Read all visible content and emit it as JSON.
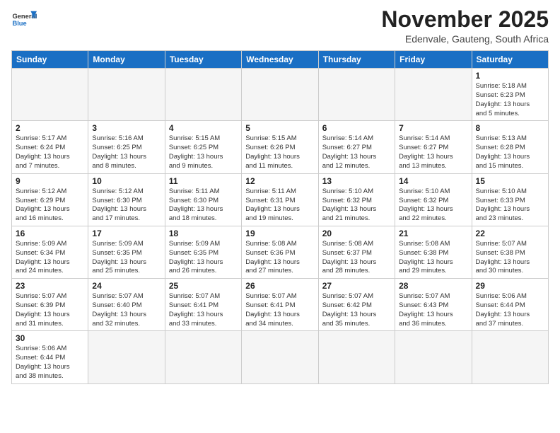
{
  "logo": {
    "text_general": "General",
    "text_blue": "Blue"
  },
  "header": {
    "month": "November 2025",
    "location": "Edenvale, Gauteng, South Africa"
  },
  "weekdays": [
    "Sunday",
    "Monday",
    "Tuesday",
    "Wednesday",
    "Thursday",
    "Friday",
    "Saturday"
  ],
  "weeks": [
    [
      {
        "day": "",
        "info": ""
      },
      {
        "day": "",
        "info": ""
      },
      {
        "day": "",
        "info": ""
      },
      {
        "day": "",
        "info": ""
      },
      {
        "day": "",
        "info": ""
      },
      {
        "day": "",
        "info": ""
      },
      {
        "day": "1",
        "info": "Sunrise: 5:18 AM\nSunset: 6:23 PM\nDaylight: 13 hours\nand 5 minutes."
      }
    ],
    [
      {
        "day": "2",
        "info": "Sunrise: 5:17 AM\nSunset: 6:24 PM\nDaylight: 13 hours\nand 7 minutes."
      },
      {
        "day": "3",
        "info": "Sunrise: 5:16 AM\nSunset: 6:25 PM\nDaylight: 13 hours\nand 8 minutes."
      },
      {
        "day": "4",
        "info": "Sunrise: 5:15 AM\nSunset: 6:25 PM\nDaylight: 13 hours\nand 9 minutes."
      },
      {
        "day": "5",
        "info": "Sunrise: 5:15 AM\nSunset: 6:26 PM\nDaylight: 13 hours\nand 11 minutes."
      },
      {
        "day": "6",
        "info": "Sunrise: 5:14 AM\nSunset: 6:27 PM\nDaylight: 13 hours\nand 12 minutes."
      },
      {
        "day": "7",
        "info": "Sunrise: 5:14 AM\nSunset: 6:27 PM\nDaylight: 13 hours\nand 13 minutes."
      },
      {
        "day": "8",
        "info": "Sunrise: 5:13 AM\nSunset: 6:28 PM\nDaylight: 13 hours\nand 15 minutes."
      }
    ],
    [
      {
        "day": "9",
        "info": "Sunrise: 5:12 AM\nSunset: 6:29 PM\nDaylight: 13 hours\nand 16 minutes."
      },
      {
        "day": "10",
        "info": "Sunrise: 5:12 AM\nSunset: 6:30 PM\nDaylight: 13 hours\nand 17 minutes."
      },
      {
        "day": "11",
        "info": "Sunrise: 5:11 AM\nSunset: 6:30 PM\nDaylight: 13 hours\nand 18 minutes."
      },
      {
        "day": "12",
        "info": "Sunrise: 5:11 AM\nSunset: 6:31 PM\nDaylight: 13 hours\nand 19 minutes."
      },
      {
        "day": "13",
        "info": "Sunrise: 5:10 AM\nSunset: 6:32 PM\nDaylight: 13 hours\nand 21 minutes."
      },
      {
        "day": "14",
        "info": "Sunrise: 5:10 AM\nSunset: 6:32 PM\nDaylight: 13 hours\nand 22 minutes."
      },
      {
        "day": "15",
        "info": "Sunrise: 5:10 AM\nSunset: 6:33 PM\nDaylight: 13 hours\nand 23 minutes."
      }
    ],
    [
      {
        "day": "16",
        "info": "Sunrise: 5:09 AM\nSunset: 6:34 PM\nDaylight: 13 hours\nand 24 minutes."
      },
      {
        "day": "17",
        "info": "Sunrise: 5:09 AM\nSunset: 6:35 PM\nDaylight: 13 hours\nand 25 minutes."
      },
      {
        "day": "18",
        "info": "Sunrise: 5:09 AM\nSunset: 6:35 PM\nDaylight: 13 hours\nand 26 minutes."
      },
      {
        "day": "19",
        "info": "Sunrise: 5:08 AM\nSunset: 6:36 PM\nDaylight: 13 hours\nand 27 minutes."
      },
      {
        "day": "20",
        "info": "Sunrise: 5:08 AM\nSunset: 6:37 PM\nDaylight: 13 hours\nand 28 minutes."
      },
      {
        "day": "21",
        "info": "Sunrise: 5:08 AM\nSunset: 6:38 PM\nDaylight: 13 hours\nand 29 minutes."
      },
      {
        "day": "22",
        "info": "Sunrise: 5:07 AM\nSunset: 6:38 PM\nDaylight: 13 hours\nand 30 minutes."
      }
    ],
    [
      {
        "day": "23",
        "info": "Sunrise: 5:07 AM\nSunset: 6:39 PM\nDaylight: 13 hours\nand 31 minutes."
      },
      {
        "day": "24",
        "info": "Sunrise: 5:07 AM\nSunset: 6:40 PM\nDaylight: 13 hours\nand 32 minutes."
      },
      {
        "day": "25",
        "info": "Sunrise: 5:07 AM\nSunset: 6:41 PM\nDaylight: 13 hours\nand 33 minutes."
      },
      {
        "day": "26",
        "info": "Sunrise: 5:07 AM\nSunset: 6:41 PM\nDaylight: 13 hours\nand 34 minutes."
      },
      {
        "day": "27",
        "info": "Sunrise: 5:07 AM\nSunset: 6:42 PM\nDaylight: 13 hours\nand 35 minutes."
      },
      {
        "day": "28",
        "info": "Sunrise: 5:07 AM\nSunset: 6:43 PM\nDaylight: 13 hours\nand 36 minutes."
      },
      {
        "day": "29",
        "info": "Sunrise: 5:06 AM\nSunset: 6:44 PM\nDaylight: 13 hours\nand 37 minutes."
      }
    ],
    [
      {
        "day": "30",
        "info": "Sunrise: 5:06 AM\nSunset: 6:44 PM\nDaylight: 13 hours\nand 38 minutes."
      },
      {
        "day": "",
        "info": ""
      },
      {
        "day": "",
        "info": ""
      },
      {
        "day": "",
        "info": ""
      },
      {
        "day": "",
        "info": ""
      },
      {
        "day": "",
        "info": ""
      },
      {
        "day": "",
        "info": ""
      }
    ]
  ]
}
